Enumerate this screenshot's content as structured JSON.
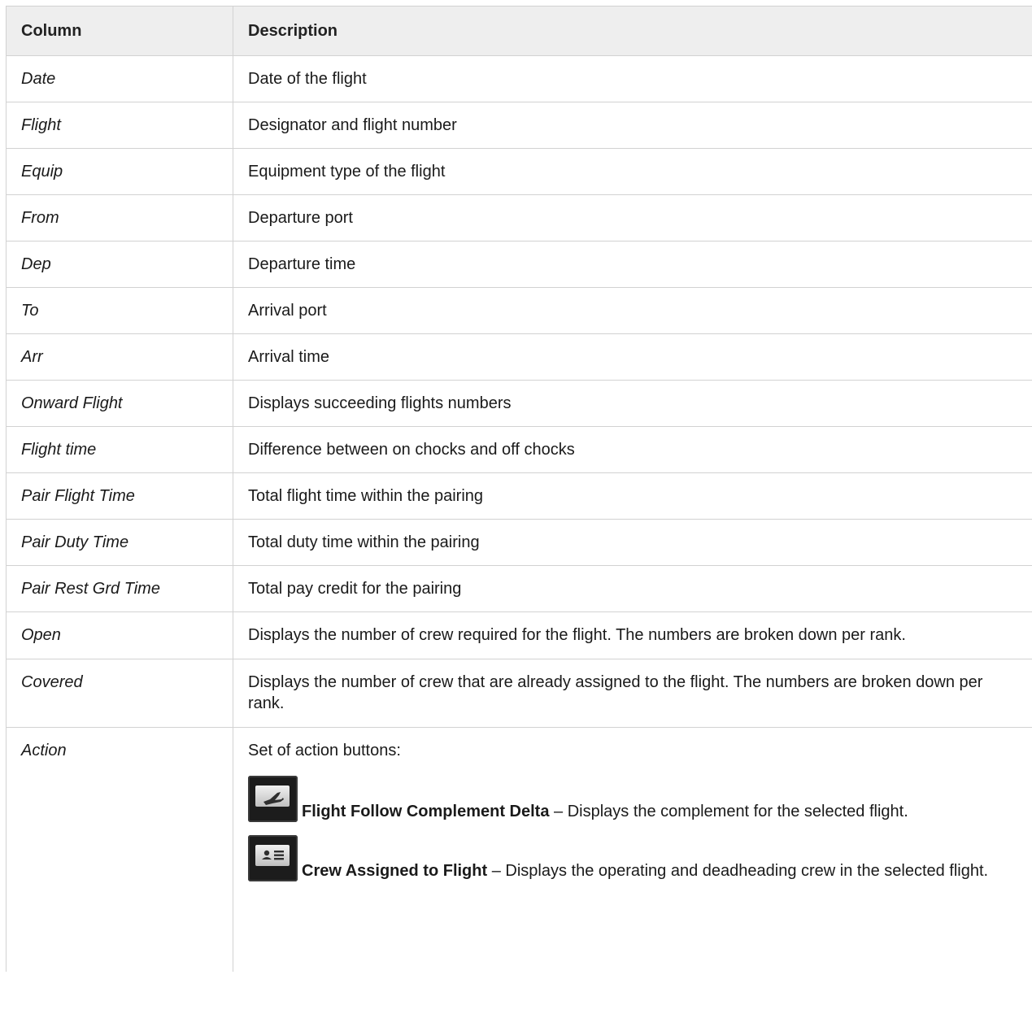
{
  "table": {
    "headers": [
      "Column",
      "Description"
    ],
    "rows": [
      {
        "term": "Date",
        "desc": "Date of the flight"
      },
      {
        "term": "Flight",
        "desc": "Designator and flight number"
      },
      {
        "term": "Equip",
        "desc": "Equipment type of the flight"
      },
      {
        "term": "From",
        "desc": "Departure port"
      },
      {
        "term": "Dep",
        "desc": "Departure time"
      },
      {
        "term": "To",
        "desc": "Arrival port"
      },
      {
        "term": "Arr",
        "desc": "Arrival time"
      },
      {
        "term": "Onward Flight",
        "desc": "Displays succeeding flights numbers"
      },
      {
        "term": "Flight time",
        "desc": "Difference between on chocks and off chocks"
      },
      {
        "term": "Pair Flight Time",
        "desc": "Total flight time within the pairing"
      },
      {
        "term": "Pair Duty Time",
        "desc": "Total duty time within the pairing"
      },
      {
        "term": "Pair Rest Grd Time",
        "desc": "Total pay credit for the pairing"
      },
      {
        "term": "Open",
        "desc": "Displays the number of crew required for the flight. The numbers are broken down per rank."
      },
      {
        "term": "Covered",
        "desc": "Displays the number of crew that are already assigned to the flight. The numbers are broken down per rank."
      }
    ],
    "action": {
      "term": "Action",
      "intro": "Set of action buttons:",
      "buttons": [
        {
          "icon": "plane-icon",
          "name": "Flight Follow Complement Delta",
          "desc": " – Displays the complement for the selected flight."
        },
        {
          "icon": "id-card-icon",
          "name": "Crew Assigned to Flight",
          "desc": " – Displays the operating and deadheading crew in the selected flight."
        }
      ]
    }
  }
}
